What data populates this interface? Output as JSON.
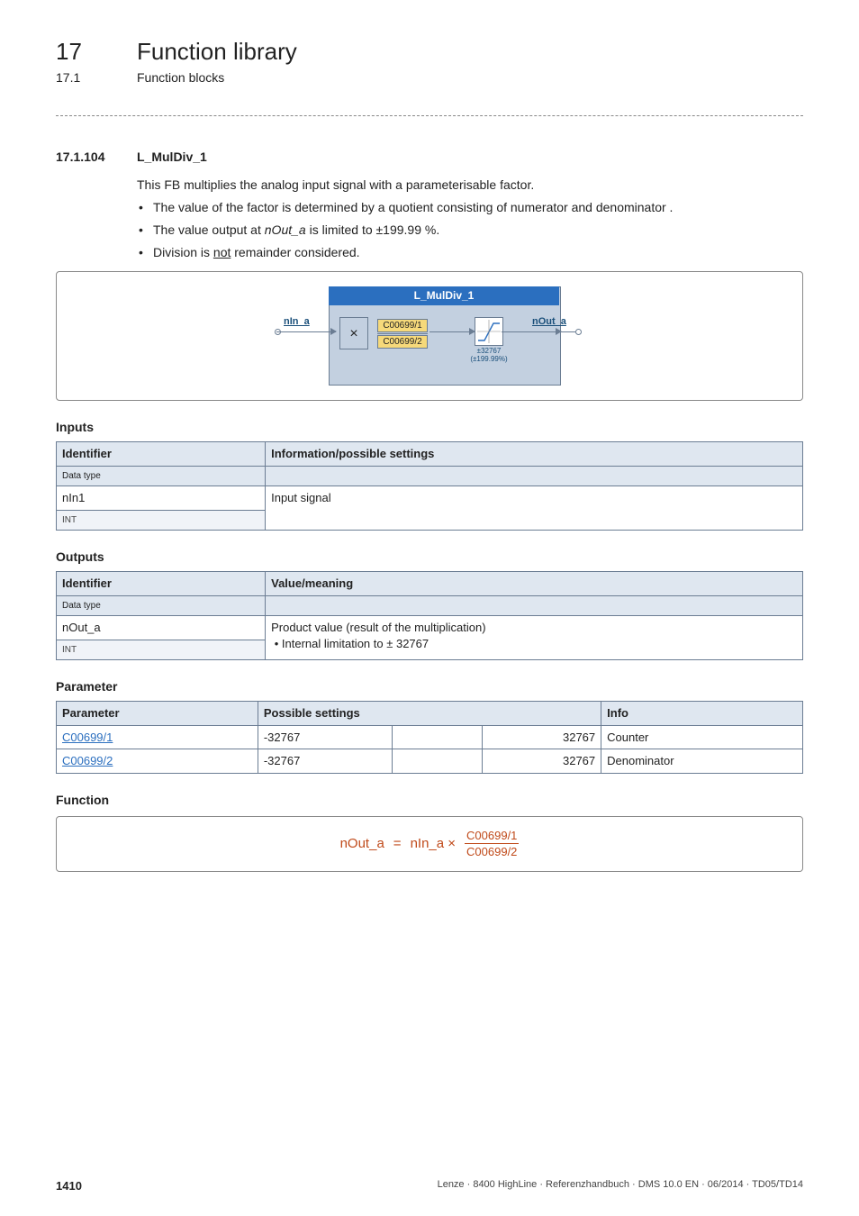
{
  "header": {
    "chapter_num": "17",
    "chapter_title": "Function library",
    "section_num": "17.1",
    "section_title": "Function blocks"
  },
  "section": {
    "num": "17.1.104",
    "title": "L_MulDiv_1",
    "intro": "This FB multiplies the analog input signal with a parameterisable factor.",
    "bullets": [
      "The value of the factor is determined by a quotient consisting of numerator  and denominator .",
      "The value output at ",
      " is limited to ±199.99 %.",
      "Division is ",
      " remainder considered."
    ],
    "italic_token": "nOut_a",
    "underline_token": "not"
  },
  "diagram": {
    "title": "L_MulDiv_1",
    "in_label": "nIn_a",
    "out_label": "nOut_a",
    "frac_num": "C00699/1",
    "frac_den": "C00699/2",
    "mul_sign": "×",
    "limit_label1": "±32767",
    "limit_label2": "(±199.99%)"
  },
  "inputs": {
    "label": "Inputs",
    "head_id": "Identifier",
    "head_info": "Information/possible settings",
    "dtype_hdr": "Data type",
    "rows": [
      {
        "name": "nIn1",
        "dtype": "INT",
        "info": "Input signal"
      }
    ]
  },
  "outputs": {
    "label": "Outputs",
    "head_id": "Identifier",
    "head_info": "Value/meaning",
    "dtype_hdr": "Data type",
    "rows": [
      {
        "name": "nOut_a",
        "dtype": "INT",
        "info_main": "Product value (result of the multiplication)",
        "info_bullet": "Internal limitation to ± 32767"
      }
    ]
  },
  "parameter": {
    "label": "Parameter",
    "head_param": "Parameter",
    "head_settings": "Possible settings",
    "head_info": "Info",
    "rows": [
      {
        "code": "C00699/1",
        "lo": "-32767",
        "hi": "32767",
        "info": "Counter"
      },
      {
        "code": "C00699/2",
        "lo": "-32767",
        "hi": "32767",
        "info": "Denominator"
      }
    ]
  },
  "function": {
    "label": "Function",
    "lhs": "nOut_a",
    "eq": "=",
    "rhs_fac": "nIn_a ×",
    "frac_num": "C00699/1",
    "frac_den": "C00699/2"
  },
  "footer": {
    "page": "1410",
    "tail": "Lenze · 8400 HighLine · Referenzhandbuch · DMS 10.0 EN · 06/2014 · TD05/TD14"
  }
}
